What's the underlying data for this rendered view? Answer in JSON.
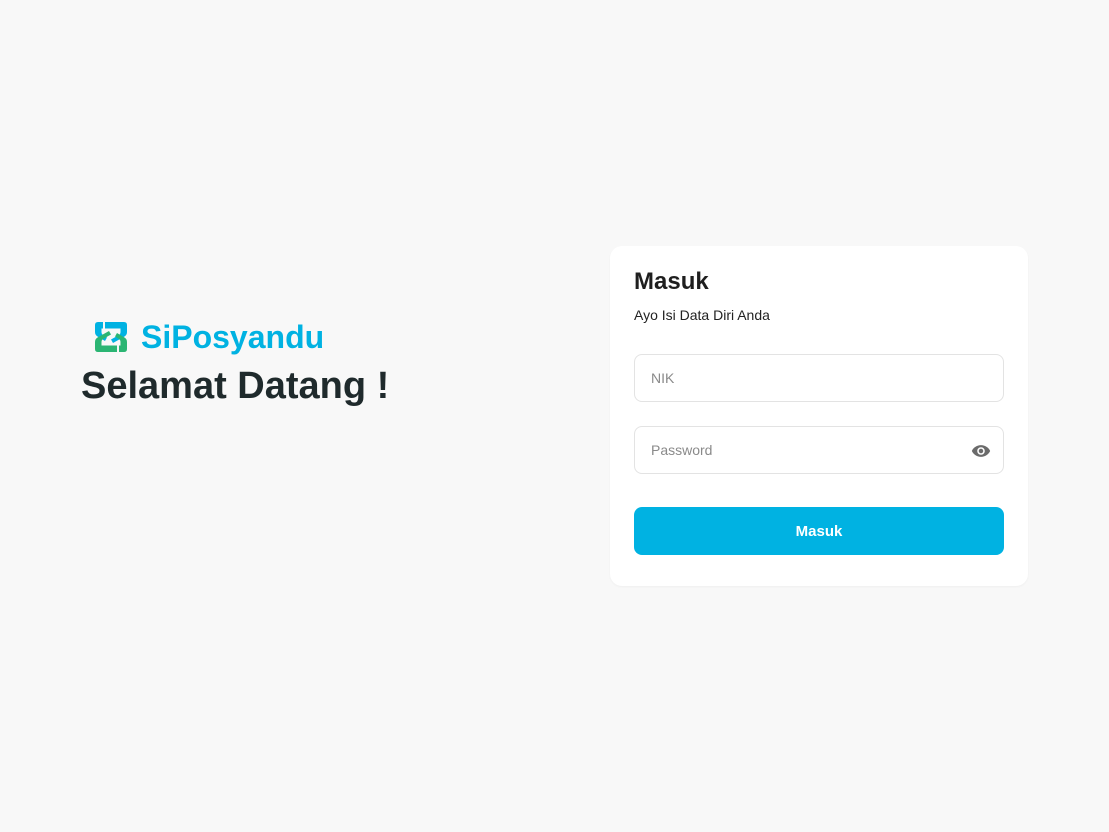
{
  "brand": {
    "name": "SiPosyandu",
    "logo_icon": "siposyandu-logo-icon",
    "welcome": "Selamat Datang !"
  },
  "login": {
    "title": "Masuk",
    "subtitle": "Ayo Isi Data Diri Anda",
    "nik": {
      "value": "",
      "placeholder": "NIK"
    },
    "password": {
      "value": "",
      "placeholder": "Password",
      "toggle_icon": "eye-icon"
    },
    "submit_label": "Masuk"
  },
  "colors": {
    "background": "#f8f8f8",
    "card": "#ffffff",
    "accent": "#00b2e2",
    "logo_green": "#2bb573",
    "logo_blue": "#00b2e2",
    "heading": "#1f2a2c"
  }
}
